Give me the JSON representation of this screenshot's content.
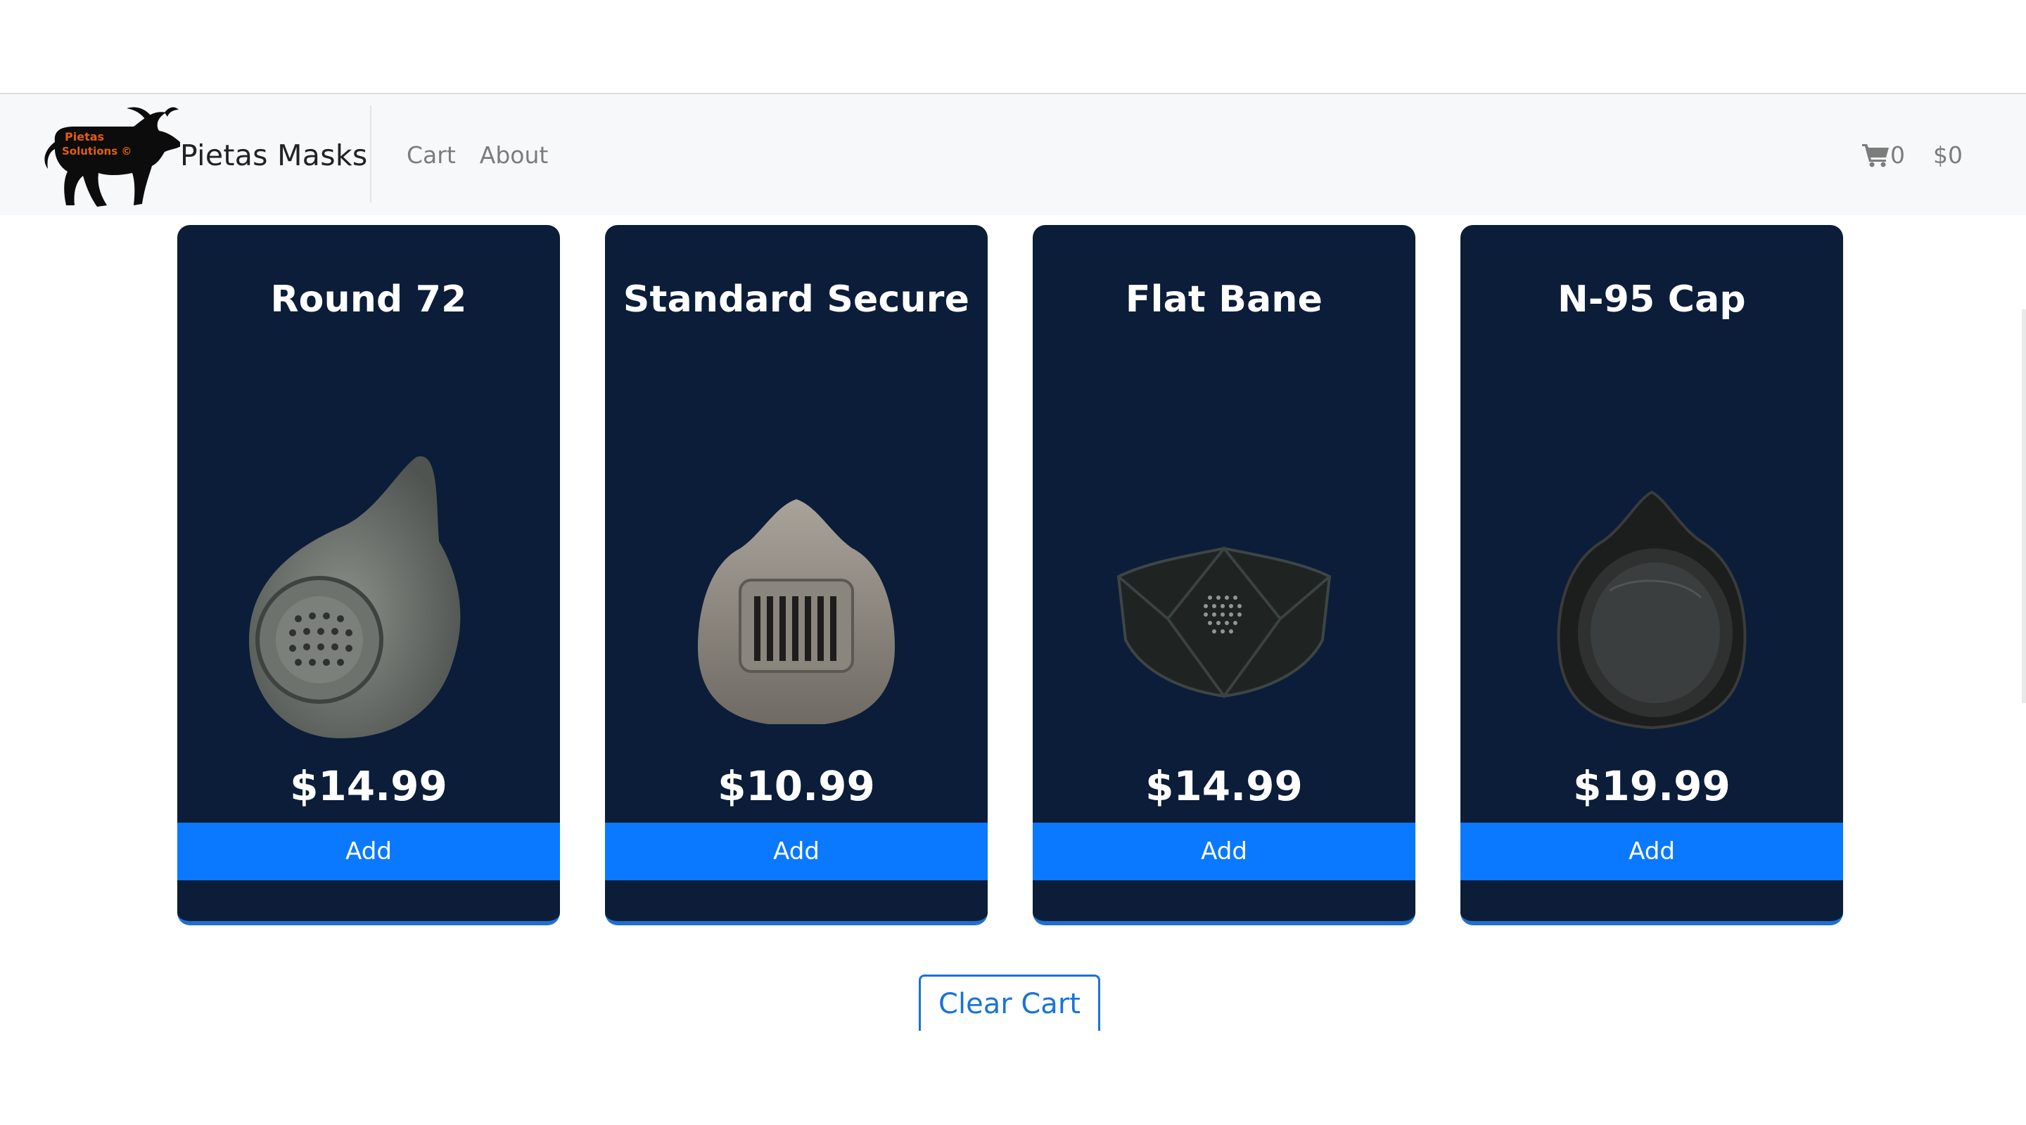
{
  "navbar": {
    "brand_name": "Pietas Masks",
    "logo_text_line1": "Pietas",
    "logo_text_line2": "Solutions ©",
    "links": [
      "Cart",
      "About"
    ],
    "cart_count": "0",
    "cart_total": "$0",
    "cart_icon": "shopping-cart-icon"
  },
  "products": [
    {
      "name": "Round 72",
      "price": "$14.99",
      "button": "Add",
      "image_icon": "round-mask-icon"
    },
    {
      "name": "Standard Secure",
      "price": "$10.99",
      "button": "Add",
      "image_icon": "standard-mask-icon"
    },
    {
      "name": "Flat Bane",
      "price": "$14.99",
      "button": "Add",
      "image_icon": "flat-mask-icon"
    },
    {
      "name": "N-95 Cap",
      "price": "$19.99",
      "button": "Add",
      "image_icon": "n95-mask-icon"
    }
  ],
  "actions": {
    "clear_cart": "Clear Cart"
  },
  "colors": {
    "card_background": "#0b1d38",
    "button_primary": "#0a79ff",
    "link_blue": "#1a73d9"
  }
}
